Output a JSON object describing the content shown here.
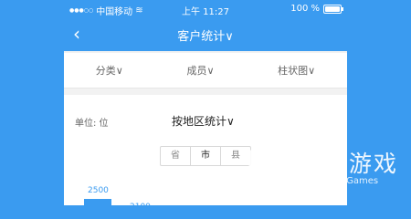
{
  "status_bar": {
    "carrier": "中国移动",
    "time": "上午 11:27",
    "battery": "100 %"
  },
  "nav": {
    "title": "客户统计∨"
  },
  "filters": [
    {
      "label": "分类∨"
    },
    {
      "label": "成员∨"
    },
    {
      "label": "柱状图∨"
    }
  ],
  "content": {
    "unit_label": "单位: 位",
    "group_by": "按地区统计∨",
    "segments": [
      {
        "label": "省"
      },
      {
        "label": "市"
      },
      {
        "label": "县"
      }
    ],
    "bars": [
      {
        "value": "2500"
      },
      {
        "value": "2100"
      }
    ]
  },
  "watermark": {
    "text": "仍玩游戏",
    "sub": "Rengwan Games"
  },
  "colors": {
    "accent": "#3a9bf0"
  }
}
